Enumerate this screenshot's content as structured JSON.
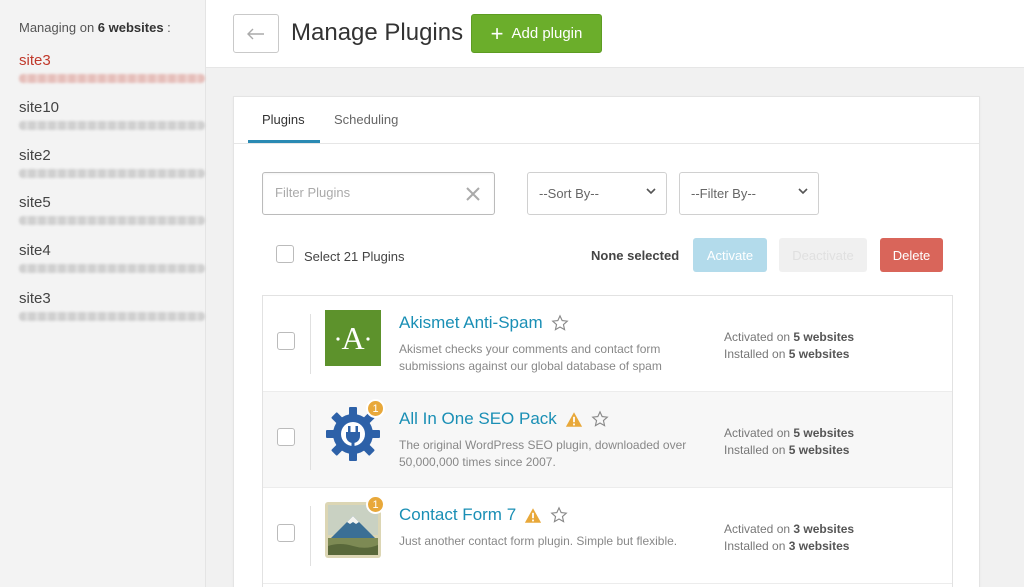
{
  "sidebar": {
    "managing_prefix": "Managing on",
    "managing_count": "6 websites",
    "managing_suffix": " :",
    "sites": [
      {
        "name": "site3"
      },
      {
        "name": "site10"
      },
      {
        "name": "site2"
      },
      {
        "name": "site5"
      },
      {
        "name": "site4"
      },
      {
        "name": "site3"
      }
    ]
  },
  "header": {
    "back_icon": "arrow-left-icon",
    "title": "Manage Plugins",
    "add_label": "Add plugin"
  },
  "tabs": [
    {
      "label": "Plugins",
      "active": true
    },
    {
      "label": "Scheduling",
      "active": false
    }
  ],
  "filters": {
    "search_placeholder": "Filter Plugins",
    "search_value": "",
    "sort_value": "--Sort By--",
    "filter_value": "--Filter By--"
  },
  "bulk": {
    "select_label": "Select 21 Plugins",
    "status": "None selected",
    "activate_label": "Activate",
    "deactivate_label": "Deactivate",
    "delete_label": "Delete"
  },
  "colors": {
    "accent": "#2a8ab3",
    "add_green": "#6bae2b",
    "delete_red": "#d9655a",
    "active_site": "#c0392b",
    "warning": "#e8a83a"
  },
  "plugins": [
    {
      "title": "Akismet Anti-Spam",
      "icon": "akismet-logo-icon",
      "icon_letter": "·A·",
      "badge": null,
      "warning": false,
      "description": "Akismet checks your comments and contact form submissions against our global database of spam",
      "activated_prefix": "Activated on",
      "activated_count": "5 websites",
      "installed_prefix": "Installed on",
      "installed_count": "5 websites"
    },
    {
      "title": "All In One SEO Pack",
      "icon": "gear-plug-icon",
      "badge": "1",
      "warning": true,
      "description": "The original WordPress SEO plugin, downloaded over 50,000,000 times since 2007.",
      "activated_prefix": "Activated on",
      "activated_count": "5 websites",
      "installed_prefix": "Installed on",
      "installed_count": "5 websites"
    },
    {
      "title": "Contact Form 7",
      "icon": "mountain-painting-icon",
      "badge": "1",
      "warning": true,
      "description": "Just another contact form plugin. Simple but flexible.",
      "activated_prefix": "Activated on",
      "activated_count": "3 websites",
      "installed_prefix": "Installed on",
      "installed_count": "3 websites"
    }
  ]
}
